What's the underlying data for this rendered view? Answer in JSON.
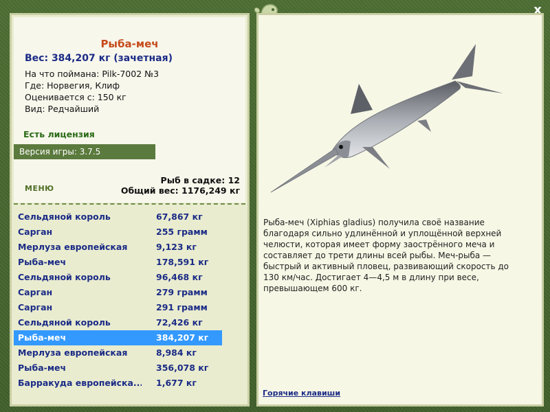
{
  "window": {
    "close_label": "x"
  },
  "fish": {
    "name": "Рыба-меч",
    "weight_line": "Вес: 384,207 кг (зачетная)",
    "bait": "На что поймана: Pilk-7002 №3",
    "location": "Где: Норвегия, Клиф",
    "valued_from": "Оценивается с: 150 кг",
    "rarity": "Вид: Редчайший"
  },
  "license": "Есть лицензия",
  "version": "Версия игры: 3.7.5",
  "menu_label": "МЕНЮ",
  "keep": {
    "count_line": "Рыб в садке: 12",
    "total_line": "Общий вес: 1176,249 кг"
  },
  "catches": [
    {
      "name": "Сельдяной король",
      "weight": "67,867 кг",
      "selected": false
    },
    {
      "name": "Сарган",
      "weight": "255 грамм",
      "selected": false
    },
    {
      "name": "Мерлуза европейская",
      "weight": "9,123 кг",
      "selected": false
    },
    {
      "name": "Рыба-меч",
      "weight": "178,591 кг",
      "selected": false
    },
    {
      "name": "Сельдяной король",
      "weight": "96,468 кг",
      "selected": false
    },
    {
      "name": "Сарган",
      "weight": "279 грамм",
      "selected": false
    },
    {
      "name": "Сарган",
      "weight": "291 грамм",
      "selected": false
    },
    {
      "name": "Сельдяной король",
      "weight": "72,426 кг",
      "selected": false
    },
    {
      "name": "Рыба-меч",
      "weight": "384,207 кг",
      "selected": true
    },
    {
      "name": "Мерлуза европейская",
      "weight": "8,984 кг",
      "selected": false
    },
    {
      "name": "Рыба-меч",
      "weight": "356,078 кг",
      "selected": false
    },
    {
      "name": "Барракуда европейска...",
      "weight": "1,677 кг",
      "selected": false
    }
  ],
  "description": "Рыба-меч (Xiphias gladius) получила своё название благодаря сильно удлинённой и уплощённой верхней челюсти, которая имеет форму заострённого меча и составляет до трети длины всей рыбы. Меч-рыба — быстрый и активный пловец, развивающий скорость до 130 км/час. Достигает 4—4,5 м в длину при весе, превышающем 600 кг.",
  "hotkeys_label": "Горячие клавиши",
  "icons": {
    "logo": "seahorse-logo-icon",
    "close": "close-icon"
  },
  "colors": {
    "selected": "#3399ff",
    "frame": "#4a6a32",
    "title": "#c64a1b",
    "list_text": "#1b2b86"
  }
}
